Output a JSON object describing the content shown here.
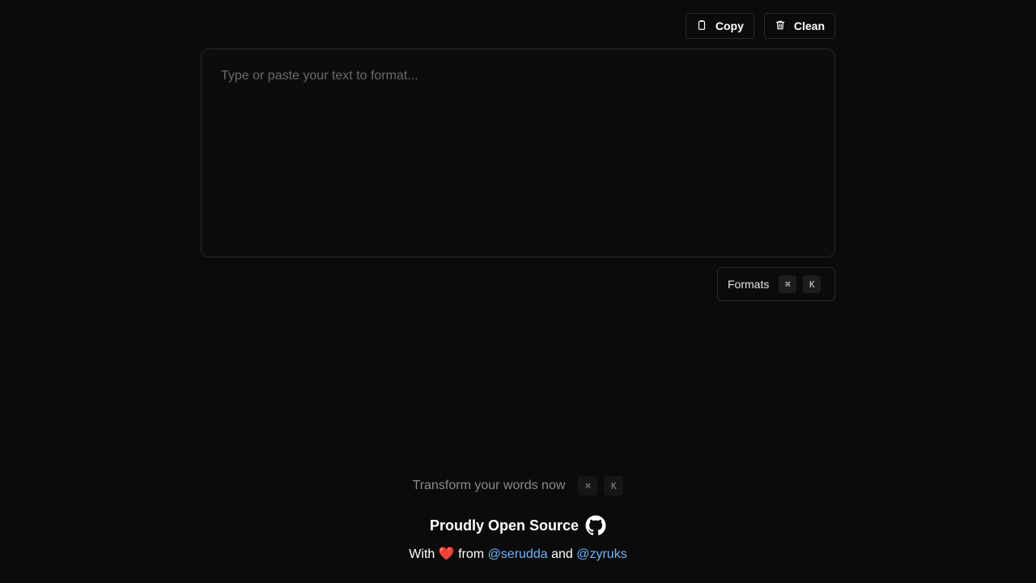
{
  "toolbar": {
    "copy_label": "Copy",
    "clean_label": "Clean"
  },
  "editor": {
    "placeholder": "Type or paste your text to format...",
    "value": ""
  },
  "formats": {
    "label": "Formats",
    "shortcut_mod": "⌘",
    "shortcut_key": "K"
  },
  "footer": {
    "hint_text": "Transform your words now",
    "hint_mod": "⌘",
    "hint_key": "K",
    "open_source_label": "Proudly Open Source",
    "credits_with": "With",
    "credits_heart": "❤️",
    "credits_from": "from",
    "author1": "@serudda",
    "credits_and": "and",
    "author2": "@zyruks"
  },
  "icons": {
    "copy": "clipboard-icon",
    "clean": "trash-icon",
    "github": "github-icon"
  },
  "colors": {
    "background": "#0b0b0b",
    "link": "#6db4ff",
    "heart": "#e0283a"
  }
}
